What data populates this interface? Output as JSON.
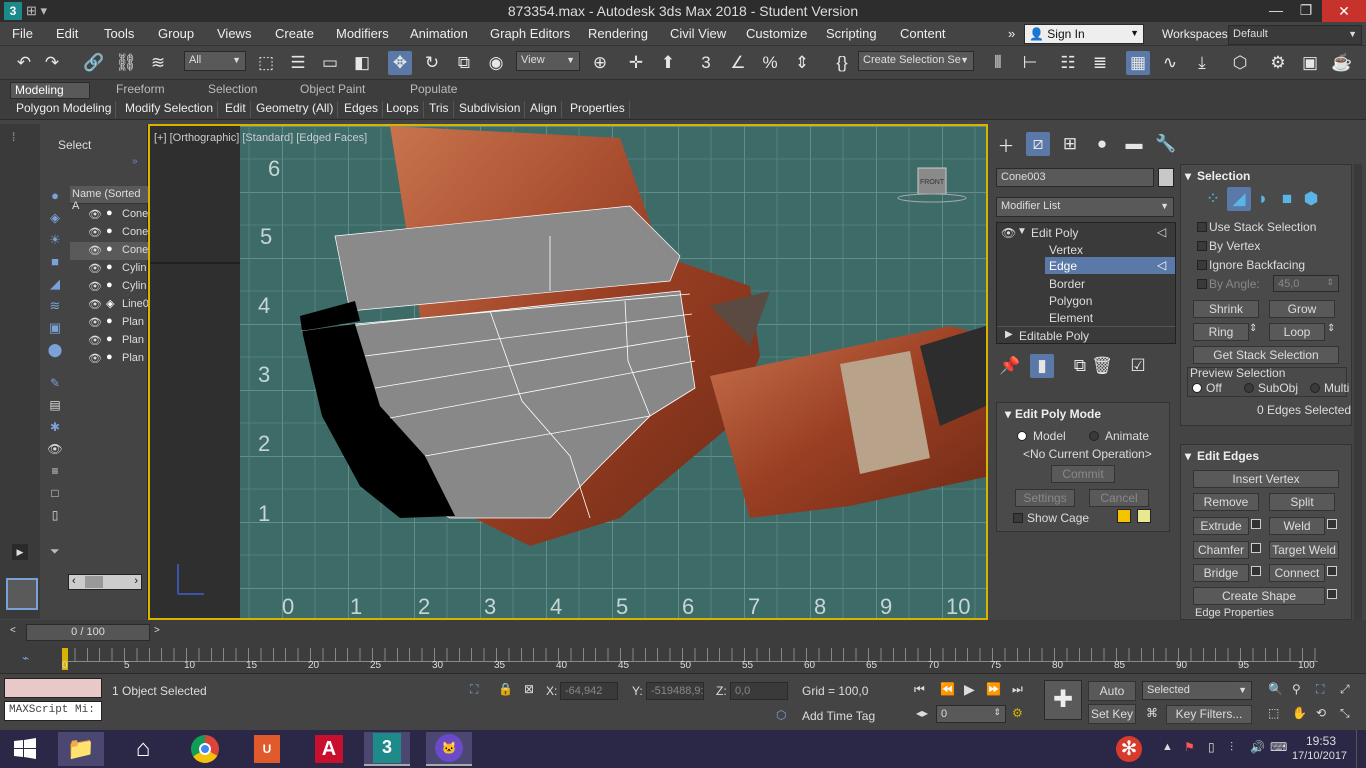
{
  "window": {
    "title": "873354.max - Autodesk 3ds Max 2018 - Student Version"
  },
  "menu": [
    "File",
    "Edit",
    "Tools",
    "Group",
    "Views",
    "Create",
    "Modifiers",
    "Animation",
    "Graph Editors",
    "Rendering",
    "Civil View",
    "Customize",
    "Scripting",
    "Content"
  ],
  "account": {
    "sign_in": "Sign In",
    "workspaces_label": "Workspaces:",
    "workspace": "Default"
  },
  "toolbar": {
    "filter": "All",
    "ref_coord": "View",
    "selection_set": "Create Selection Se"
  },
  "ribbon": {
    "tabs": [
      "Modeling",
      "Freeform",
      "Selection",
      "Object Paint",
      "Populate"
    ],
    "subtabs": [
      "Polygon Modeling",
      "Modify Selection",
      "Edit",
      "Geometry (All)",
      "Edges",
      "Loops",
      "Tris",
      "Subdivision",
      "Align",
      "Properties"
    ]
  },
  "scene_explorer": {
    "title": "Select",
    "column": "Name (Sorted A",
    "rows": [
      "Cone",
      "Cone",
      "Cone",
      "Cylin",
      "Cylin",
      "Line0",
      "Plan",
      "Plan",
      "Plan"
    ]
  },
  "viewport": {
    "label_plus": "[+]",
    "label_view": "[Orthographic]",
    "label_shading": "[Standard]",
    "label_edged": "[Edged Faces]",
    "viewcube": "FRONT",
    "ruler_y": [
      "6",
      "5",
      "4",
      "3",
      "2",
      "1"
    ],
    "ruler_x": [
      "0",
      "1",
      "2",
      "3",
      "4",
      "5",
      "6",
      "7",
      "8",
      "9",
      "10"
    ]
  },
  "command_panel": {
    "object_name": "Cone003",
    "modifier_list": "Modifier List",
    "stack": {
      "edit_poly": "Edit Poly",
      "items": [
        "Vertex",
        "Edge",
        "Border",
        "Polygon",
        "Element"
      ],
      "selected": "Edge",
      "base": "Editable Poly"
    },
    "edit_poly_mode": {
      "title": "Edit Poly Mode",
      "model": "Model",
      "animate": "Animate",
      "operation": "<No Current Operation>",
      "commit": "Commit",
      "settings": "Settings",
      "cancel": "Cancel",
      "show_cage": "Show Cage"
    },
    "selection": {
      "title": "Selection",
      "use_stack": "Use Stack Selection",
      "by_vertex": "By Vertex",
      "ignore_backfacing": "Ignore Backfacing",
      "by_angle": "By Angle:",
      "angle_value": "45,0",
      "shrink": "Shrink",
      "grow": "Grow",
      "ring": "Ring",
      "loop": "Loop",
      "get_stack": "Get Stack Selection",
      "preview": "Preview Selection",
      "off": "Off",
      "subobj": "SubObj",
      "multi": "Multi",
      "status": "0 Edges Selected"
    },
    "edit_edges": {
      "title": "Edit Edges",
      "insert_vertex": "Insert Vertex",
      "remove": "Remove",
      "split": "Split",
      "extrude": "Extrude",
      "weld": "Weld",
      "chamfer": "Chamfer",
      "target_weld": "Target Weld",
      "bridge": "Bridge",
      "connect": "Connect",
      "create_shape": "Create Shape",
      "edge_properties": "Edge Properties"
    }
  },
  "timeline": {
    "frame": "0 / 100",
    "ticks": [
      "0",
      "5",
      "10",
      "15",
      "20",
      "25",
      "30",
      "35",
      "40",
      "45",
      "50",
      "55",
      "60",
      "65",
      "70",
      "75",
      "80",
      "85",
      "90",
      "95",
      "100"
    ]
  },
  "status": {
    "maxscript": "MAXScript Mi:",
    "objects": "1 Object Selected",
    "x_label": "X:",
    "x": "-64,942",
    "y_label": "Y:",
    "y": "-519488,9:",
    "z_label": "Z:",
    "z": "0,0",
    "grid": "Grid = 100,0",
    "add_time_tag": "Add Time Tag",
    "frame_field": "0",
    "auto_key": "Auto Key",
    "set_key": "Set Key",
    "key_mode": "Selected",
    "key_filters": "Key Filters..."
  },
  "taskbar": {
    "time": "19:53",
    "date": "17/10/2017"
  },
  "colors": {
    "accent": "#5a78a8",
    "viewport_border": "#d8b400",
    "cage1": "#f5c400",
    "cage2": "#e8e890"
  }
}
